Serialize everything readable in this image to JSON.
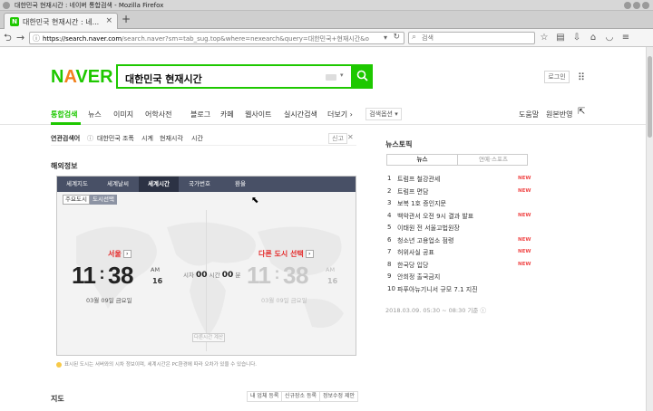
{
  "window": {
    "title": "대한민국 현재시간 : 네이버 통합검색 - Mozilla Firefox",
    "tab_title": "대한민국 현재시간 : 네...",
    "new_tab": "+"
  },
  "navbar": {
    "url_domain": "https://search.naver.com",
    "url_rest": "/search.naver?sm=tab_sug.top&where=nexearch&query=대한민국+현재시간&oquery=현",
    "search_placeholder": "검색"
  },
  "naver": {
    "logo": "NAVER",
    "query": "대한민국 현재시간",
    "login": "로그인"
  },
  "gnb": {
    "items": [
      "통합검색",
      "뉴스",
      "이미지",
      "어학사전",
      "블로그",
      "카페",
      "웹사이트",
      "실시간검색",
      "더보기"
    ],
    "options": "검색옵션",
    "right": [
      "도움말",
      "원본반영"
    ]
  },
  "related": {
    "label": "연관검색어",
    "keywords": [
      "대한민국 조폭",
      "시계",
      "현재시각",
      "시간"
    ],
    "report": "신고",
    "close": "✕"
  },
  "world_clock": {
    "section_title": "해외정보",
    "tabs": [
      "세계지도",
      "세계날씨",
      "세계시간",
      "국가번호",
      "환율"
    ],
    "subtabs": [
      "주요도시",
      "도시선택"
    ],
    "left": {
      "city": "서울",
      "hour": "11",
      "minute": "38",
      "ampm": "AM",
      "sec": "16",
      "date": "03월 09일 금요일"
    },
    "right": {
      "city": "다른 도시 선택",
      "hour": "11",
      "minute": "38",
      "ampm": "AM",
      "sec": "16",
      "date": "03월 09일 금요일"
    },
    "diff_prefix": "시차",
    "diff_h": "00",
    "diff_h_unit": "시간",
    "diff_m": "00",
    "diff_m_unit": "분",
    "calc_button": "다른시간 계산",
    "note": "표시된 도시는 서버와의 시차 정보이며, 세계시간은 PC환경에 따라 오차가 있을 수 있습니다."
  },
  "map_section": {
    "title": "지도",
    "links": [
      "내 업체 등록",
      "신규장소 등록",
      "정보수정 제안"
    ]
  },
  "news_topic": {
    "title": "뉴스토픽",
    "tabs": [
      "뉴스",
      "연예·스포츠"
    ],
    "items": [
      {
        "rank": "1",
        "text": "트럼프 철강관세",
        "new": "NEW"
      },
      {
        "rank": "2",
        "text": "트럼프 면담",
        "new": "NEW"
      },
      {
        "rank": "3",
        "text": "보복 1호 증인지문",
        "new": ""
      },
      {
        "rank": "4",
        "text": "백악관서 오전 9시 결과 발표",
        "new": "NEW"
      },
      {
        "rank": "5",
        "text": "이태원 전 서울고법원장",
        "new": ""
      },
      {
        "rank": "6",
        "text": "청소년 고용업소 점령",
        "new": "NEW"
      },
      {
        "rank": "7",
        "text": "허위사실 공표",
        "new": "NEW"
      },
      {
        "rank": "8",
        "text": "한국당 입당",
        "new": "NEW"
      },
      {
        "rank": "9",
        "text": "안희정 출국금지",
        "new": ""
      },
      {
        "rank": "10",
        "text": "파푸아뉴기니서 규모 7.1 지진",
        "new": ""
      }
    ],
    "timestamp": "2018.03.09. 05:30 ~ 08:30 기준"
  },
  "colors": {
    "naver_green": "#1ec800",
    "new_red": "#f04a4a",
    "city_red": "#e52b2b"
  }
}
